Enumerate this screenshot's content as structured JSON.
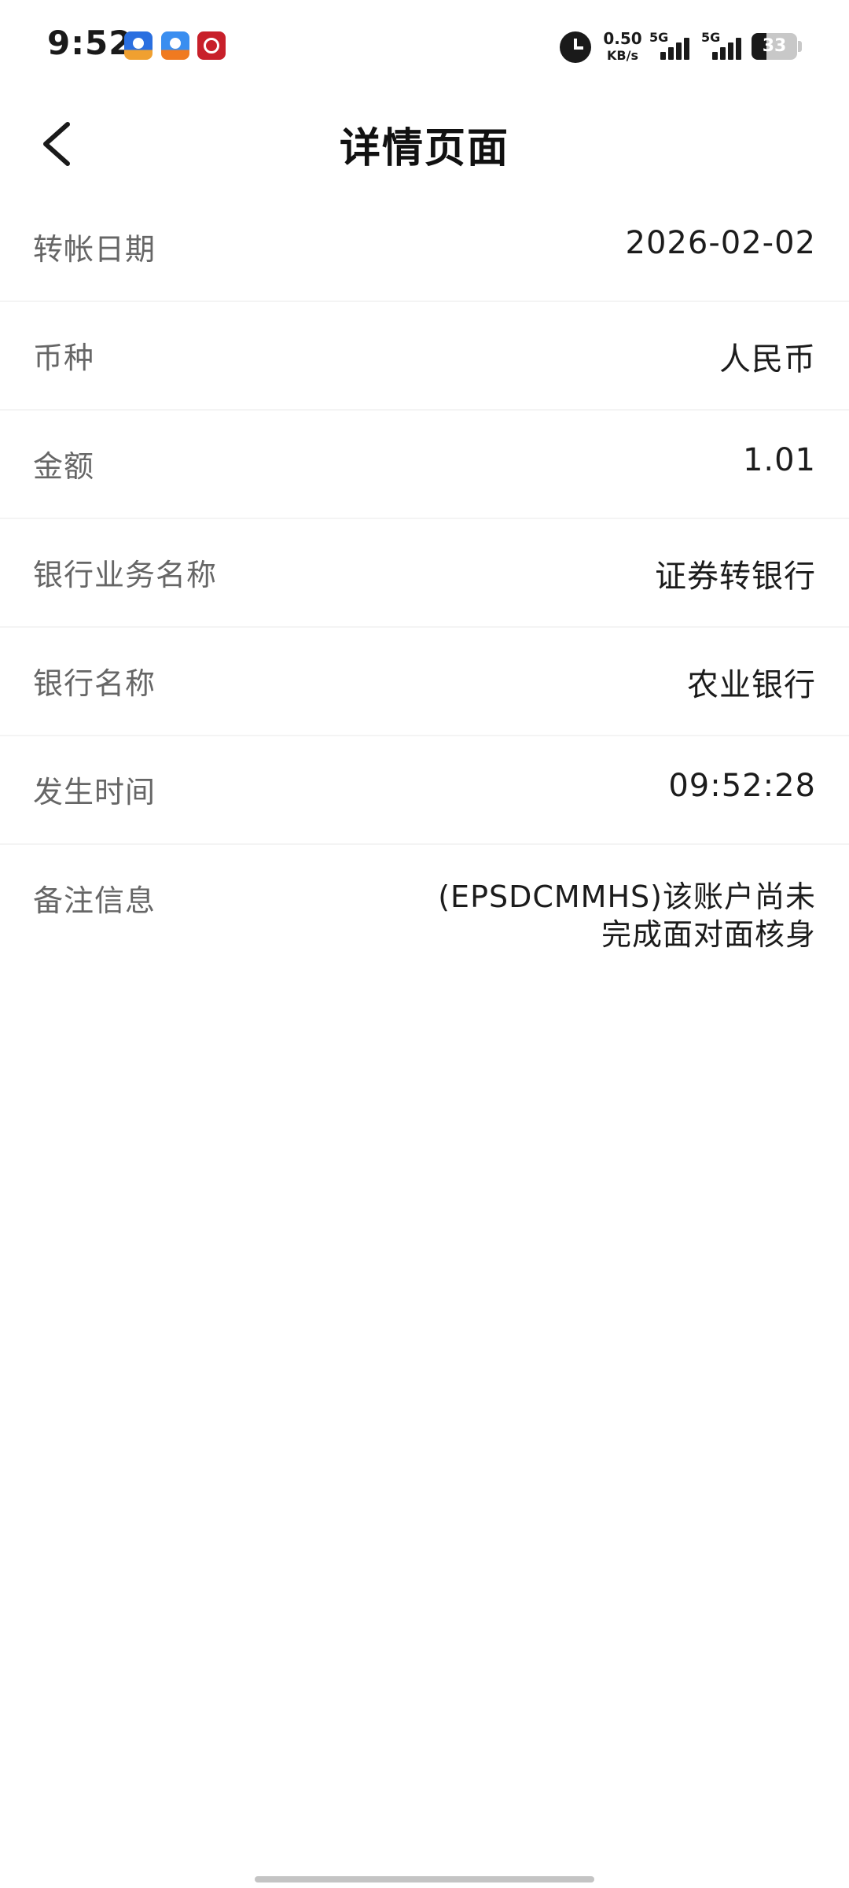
{
  "status_bar": {
    "time": "9:52",
    "net_speed_value": "0.50",
    "net_speed_unit": "KB/s",
    "signal_1": "5G",
    "signal_2": "5G",
    "battery": "33",
    "icons": [
      "app-notification-icon-1",
      "app-notification-icon-2",
      "app-notification-icon-3",
      "alarm-icon"
    ]
  },
  "header": {
    "title": "详情页面",
    "back_icon": "chevron-left-icon"
  },
  "details": [
    {
      "label": "转帐日期",
      "value": "2026-02-02"
    },
    {
      "label": "币种",
      "value": "人民币"
    },
    {
      "label": "金额",
      "value": "1.01"
    },
    {
      "label": "银行业务名称",
      "value": "证券转银行"
    },
    {
      "label": "银行名称",
      "value": "农业银行"
    },
    {
      "label": "发生时间",
      "value": "09:52:28"
    },
    {
      "label": "备注信息",
      "value": "(EPSDCMMHS)该账户尚未完成面对面核身"
    }
  ],
  "colors": {
    "background": "#ffffff",
    "label": "#666666",
    "value": "#1c1c1c",
    "divider": "#f4f4f4"
  }
}
